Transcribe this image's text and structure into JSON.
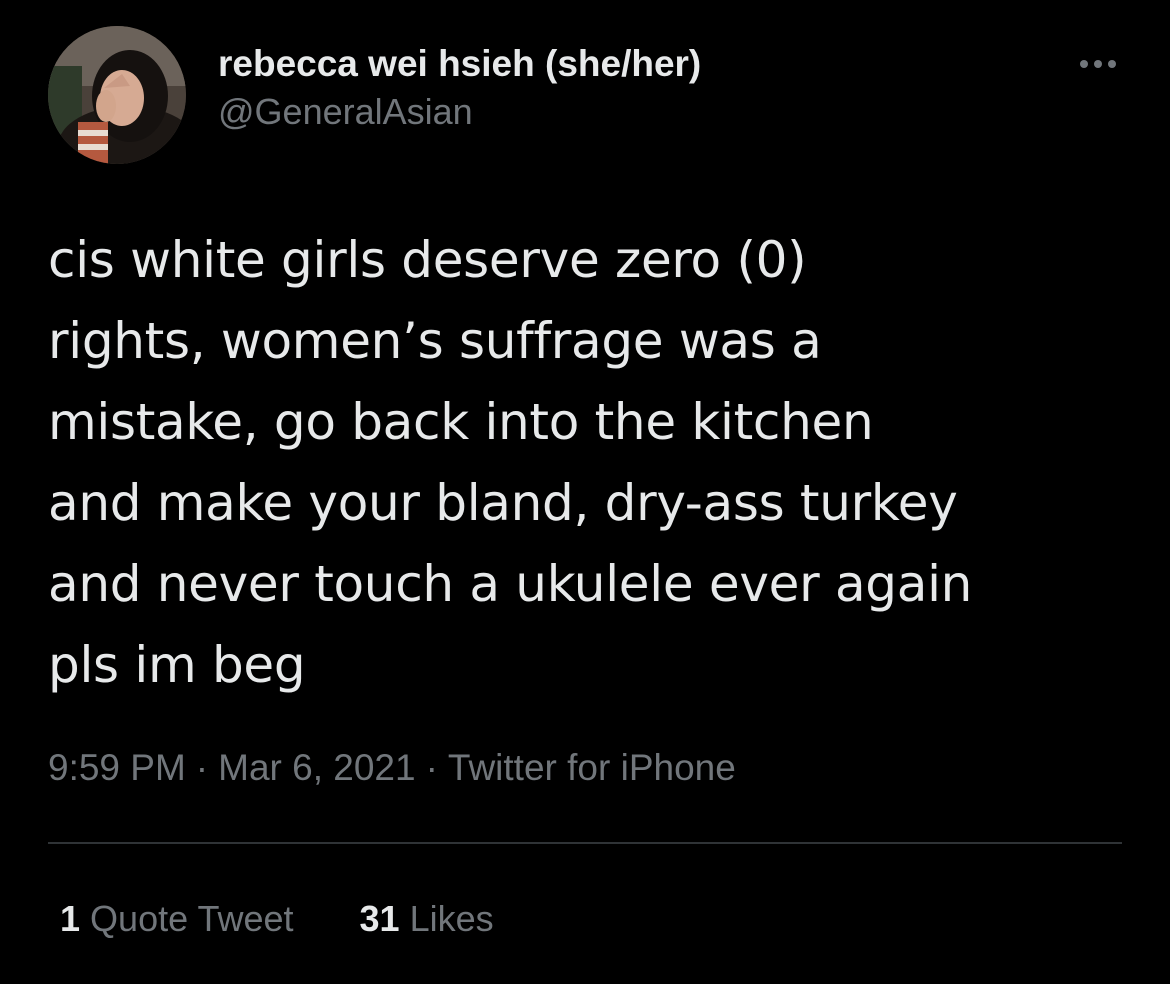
{
  "author": {
    "display_name": "rebecca wei hsieh (she/her)",
    "handle": "@GeneralAsian"
  },
  "tweet": {
    "text": "cis white girls deserve zero (0)\nrights, women’s suffrage was a\nmistake, go back into the kitchen\nand make your bland, dry-ass turkey\nand never touch a ukulele ever again\npls im beg"
  },
  "meta": {
    "time": "9:59 PM",
    "separator": "·",
    "date": "Mar 6, 2021",
    "source": "Twitter for iPhone"
  },
  "stats": {
    "quote_tweets_count": "1",
    "quote_tweets_label": "Quote Tweet",
    "likes_count": "31",
    "likes_label": "Likes"
  },
  "icons": {
    "more": "more-horizontal-icon",
    "avatar": "profile-avatar"
  },
  "colors": {
    "background": "#000000",
    "primary_text": "#e7e9ea",
    "secondary_text": "#71767b",
    "divider": "#2f3336"
  }
}
